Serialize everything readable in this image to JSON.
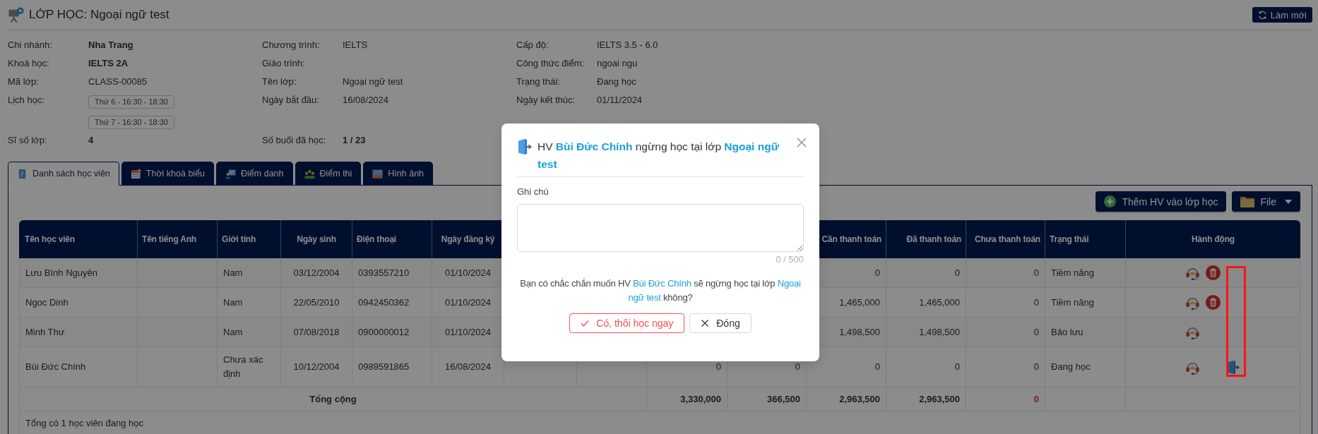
{
  "header": {
    "title": "LỚP HỌC: Ngoại ngữ test",
    "refresh_button": "Làm mới"
  },
  "info_rows": [
    [
      {
        "label": "Chi nhánh:",
        "value": "Nha Trang",
        "bold": true
      },
      {
        "label": "Chương trình:",
        "value": "IELTS",
        "bold": false
      },
      {
        "label": "Cấp độ:",
        "value": "IELTS 3.5 - 6.0",
        "bold": false
      }
    ],
    [
      {
        "label": "Khoá học:",
        "value": "IELTS 2A",
        "bold": true
      },
      {
        "label": "Giáo trình:"
      },
      {
        "label": "Công thức điểm:",
        "value": "ngoai ngu",
        "bold": false
      }
    ],
    [
      {
        "label": "Mã lớp:",
        "value": "CLASS-00085",
        "bold": false
      },
      {
        "label": "Tên lớp:",
        "value": "Ngoại ngữ test",
        "bold": false
      },
      {
        "label": "Trạng thái:",
        "value": "Đang học",
        "bold": false
      }
    ],
    [
      {
        "label": "Lịch học:",
        "chips": [
          "Thứ 6 - 16:30 - 18:30",
          "Thứ 7 - 16:30 - 18:30"
        ]
      },
      {
        "label": "Ngày bắt đầu:",
        "value": "16/08/2024",
        "bold": false
      },
      {
        "label": "Ngày kết thúc:",
        "value": "01/11/2024",
        "bold": false
      }
    ],
    [
      {
        "label": "Sĩ số lớp:",
        "value": "4",
        "bold": true
      },
      {
        "label": "Số buổi đã học:",
        "value": "1 / 23",
        "bold": true
      }
    ]
  ],
  "tabs": [
    {
      "label": "Danh sách học viên",
      "selected": true
    },
    {
      "label": "Thời khoá biểu",
      "selected": false
    },
    {
      "label": "Điểm danh",
      "selected": false
    },
    {
      "label": "Điểm thi",
      "selected": false
    },
    {
      "label": "Hình ảnh",
      "selected": false
    }
  ],
  "toolbar": {
    "add_button": "Thêm HV vào lớp học",
    "file_button": "File"
  },
  "table": {
    "columns": [
      "Tên học viên",
      "Tên tiếng Anh",
      "Giới tính",
      "Ngày sinh",
      "Điện thoại",
      "Ngày đăng ký",
      null,
      null,
      null,
      null,
      "Cần thanh toán",
      "Đã thanh toán",
      "Chưa thanh toán",
      "Trạng thái",
      "Hành động"
    ],
    "rows": [
      {
        "cells": [
          "Lưu Bình Nguyên",
          null,
          "Nam",
          "03/12/2004",
          "0393557210",
          "01/10/2024",
          null,
          null,
          null,
          null,
          "0",
          "0",
          "0",
          "Tiềm năng"
        ],
        "actions": [
          {
            "kind": "headset"
          },
          {
            "kind": "trash"
          }
        ]
      },
      {
        "cells": [
          "Ngoc Dinh",
          null,
          "Nam",
          "22/05/2010",
          "0942450362",
          "01/10/2024",
          null,
          null,
          null,
          null,
          "1,465,000",
          "1,465,000",
          "0",
          "Tiềm năng"
        ],
        "actions": [
          {
            "kind": "headset"
          },
          {
            "kind": "trash"
          }
        ]
      },
      {
        "cells": [
          "Minh Thư",
          null,
          "Nam",
          "07/08/2018",
          "0900000012",
          "01/10/2024",
          null,
          null,
          null,
          null,
          "1,498,500",
          "1,498,500",
          "0",
          "Bảo lưu"
        ],
        "actions": [
          {
            "kind": "headset"
          }
        ]
      },
      {
        "cells": [
          "Bùi Đức Chính",
          null,
          "Chưa xác định",
          "10/12/2004",
          "0989591865",
          "16/08/2024",
          null,
          null,
          "0",
          "0",
          "0",
          "0",
          "0",
          "Đang học"
        ],
        "actions": [
          {
            "kind": "headset"
          },
          {
            "kind": "exit"
          }
        ]
      }
    ],
    "total": {
      "label": "Tổng cộng",
      "values": [
        {
          "text": "3,330,000",
          "highlighted": false
        },
        {
          "text": "366,500",
          "highlighted": false
        },
        {
          "text": "2,963,500",
          "highlighted": false
        },
        {
          "text": "2,963,500",
          "highlighted": false
        },
        {
          "text": "0",
          "highlighted": true
        }
      ]
    },
    "footer": "Tổng có 1 học viên đang học"
  },
  "modal": {
    "title": [
      {
        "kind": "plain",
        "text": "HV "
      },
      {
        "kind": "highlight",
        "text": "Bùi Đức Chính"
      },
      {
        "kind": "plain",
        "text": " ngừng học tại lớp "
      },
      {
        "kind": "highlight",
        "text": "Ngoại ngữ test"
      }
    ],
    "note_label": "Ghi chú",
    "note_counter": "0 / 500",
    "message": [
      {
        "kind": "plain",
        "text": "Bạn có chắc chắn muốn HV "
      },
      {
        "kind": "highlight",
        "text": "Bùi Đức Chính"
      },
      {
        "kind": "plain",
        "text": " sẽ ngừng học tại lớp "
      },
      {
        "kind": "highlight",
        "text": "Ngoại ngữ test"
      },
      {
        "kind": "plain",
        "text": " không?"
      }
    ],
    "confirm_button": "Có, thôi học ngay",
    "close_button": "Đóng"
  }
}
